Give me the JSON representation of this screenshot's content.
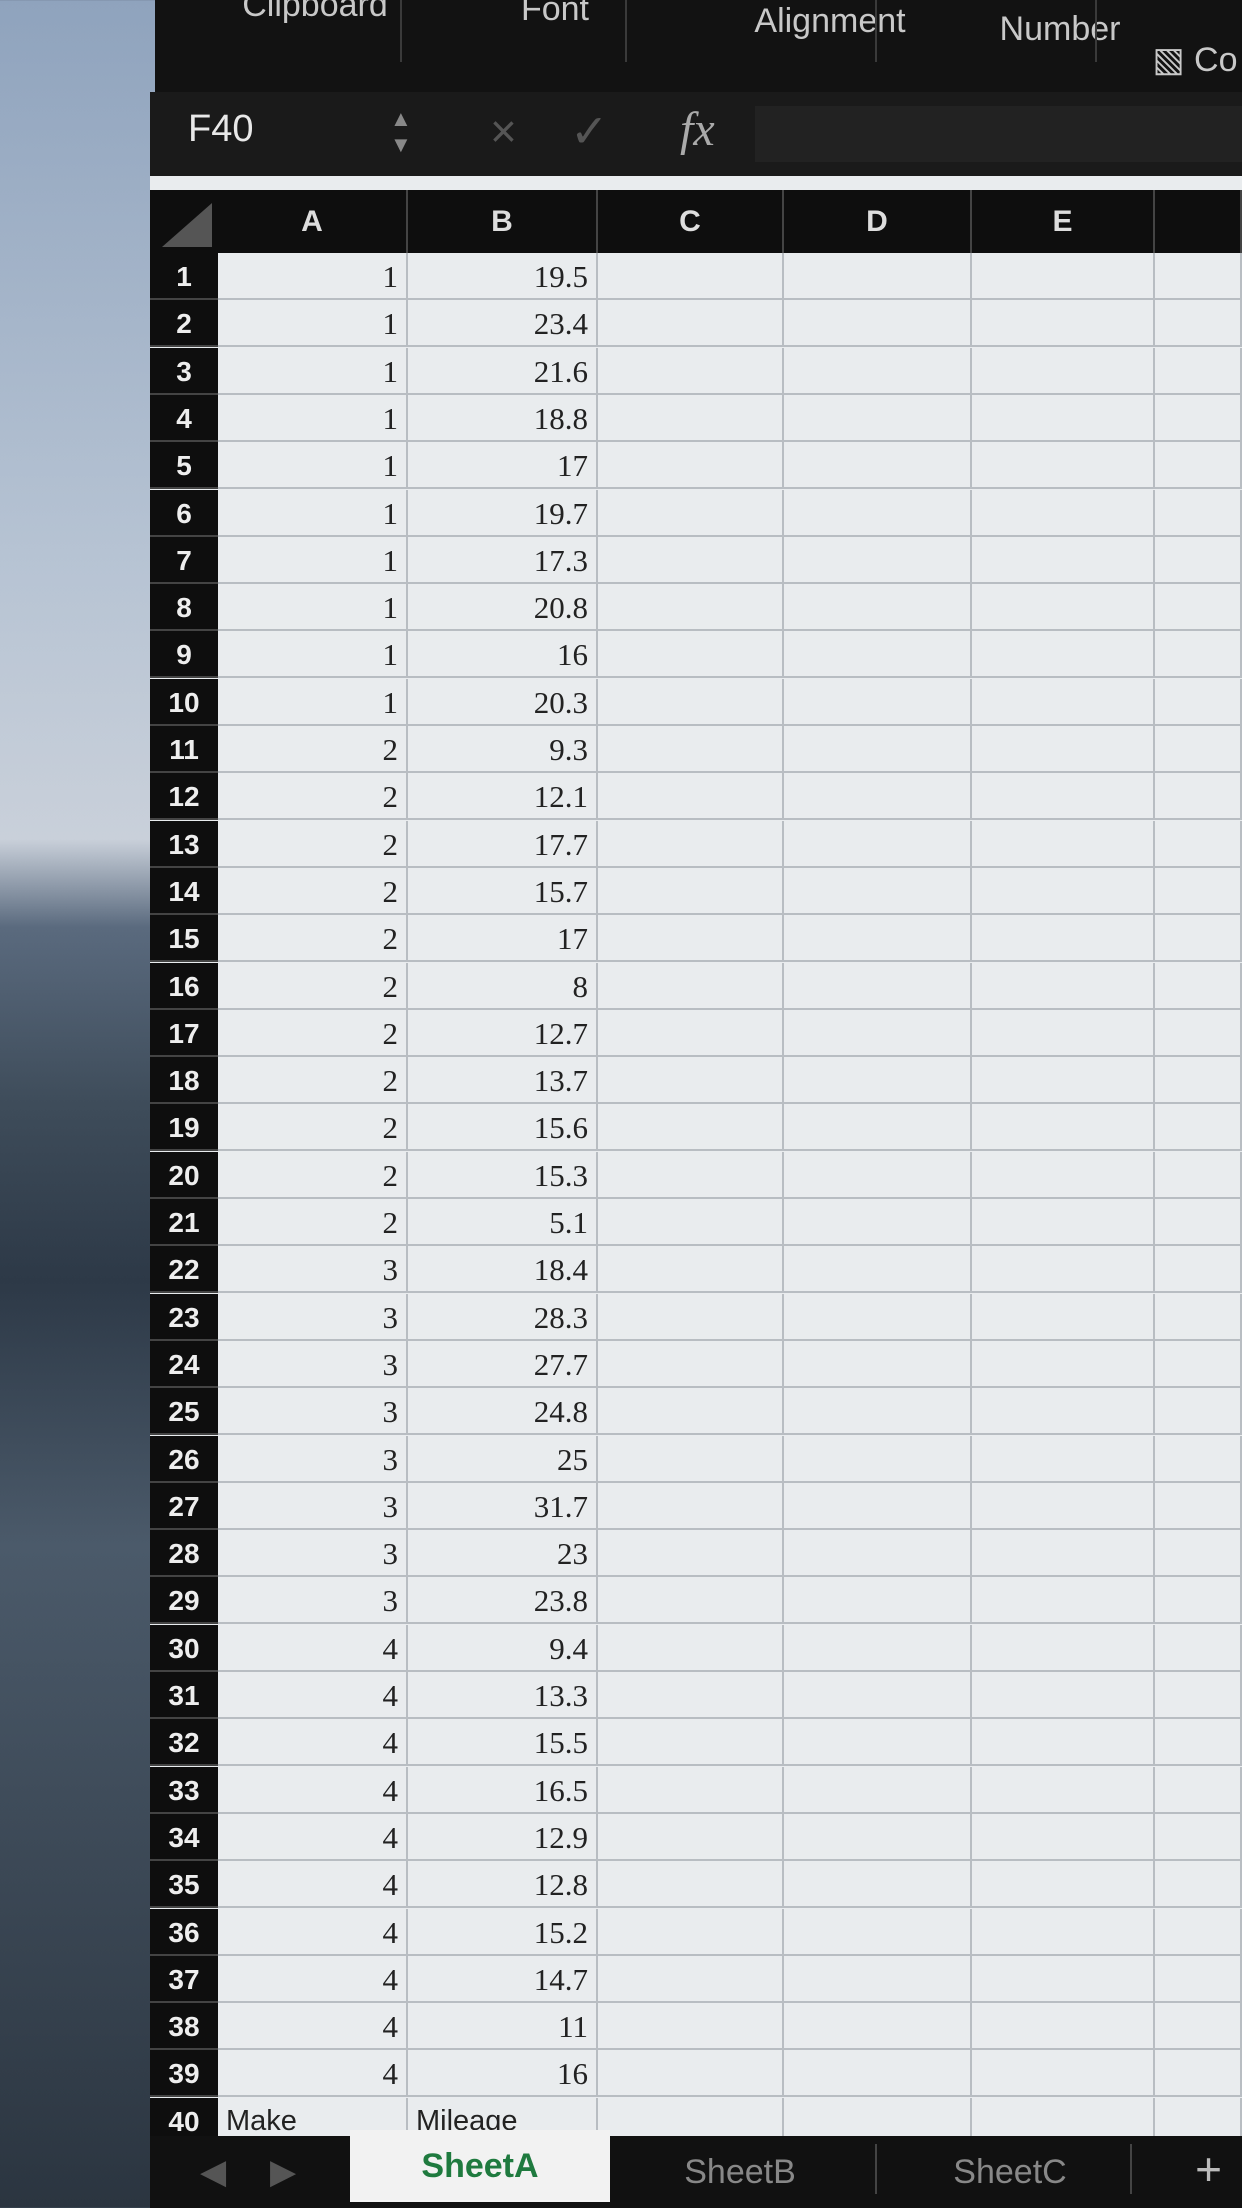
{
  "ribbon": {
    "groups": [
      "Clipboard",
      "Font",
      "Alignment",
      "Number"
    ],
    "partial": "Co"
  },
  "formula_bar": {
    "name_box": "F40",
    "cancel_icon": "×",
    "enter_icon": "✓",
    "fx_label": "fx",
    "value": ""
  },
  "columns": [
    "A",
    "B",
    "C",
    "D",
    "E",
    ""
  ],
  "rows": [
    [
      "1",
      "1",
      "19.5"
    ],
    [
      "2",
      "1",
      "23.4"
    ],
    [
      "3",
      "1",
      "21.6"
    ],
    [
      "4",
      "1",
      "18.8"
    ],
    [
      "5",
      "1",
      "17"
    ],
    [
      "6",
      "1",
      "19.7"
    ],
    [
      "7",
      "1",
      "17.3"
    ],
    [
      "8",
      "1",
      "20.8"
    ],
    [
      "9",
      "1",
      "16"
    ],
    [
      "10",
      "1",
      "20.3"
    ],
    [
      "11",
      "2",
      "9.3"
    ],
    [
      "12",
      "2",
      "12.1"
    ],
    [
      "13",
      "2",
      "17.7"
    ],
    [
      "14",
      "2",
      "15.7"
    ],
    [
      "15",
      "2",
      "17"
    ],
    [
      "16",
      "2",
      "8"
    ],
    [
      "17",
      "2",
      "12.7"
    ],
    [
      "18",
      "2",
      "13.7"
    ],
    [
      "19",
      "2",
      "15.6"
    ],
    [
      "20",
      "2",
      "15.3"
    ],
    [
      "21",
      "2",
      "5.1"
    ],
    [
      "22",
      "3",
      "18.4"
    ],
    [
      "23",
      "3",
      "28.3"
    ],
    [
      "24",
      "3",
      "27.7"
    ],
    [
      "25",
      "3",
      "24.8"
    ],
    [
      "26",
      "3",
      "25"
    ],
    [
      "27",
      "3",
      "31.7"
    ],
    [
      "28",
      "3",
      "23"
    ],
    [
      "29",
      "3",
      "23.8"
    ],
    [
      "30",
      "4",
      "9.4"
    ],
    [
      "31",
      "4",
      "13.3"
    ],
    [
      "32",
      "4",
      "15.5"
    ],
    [
      "33",
      "4",
      "16.5"
    ],
    [
      "34",
      "4",
      "12.9"
    ],
    [
      "35",
      "4",
      "12.8"
    ],
    [
      "36",
      "4",
      "15.2"
    ],
    [
      "37",
      "4",
      "14.7"
    ],
    [
      "38",
      "4",
      "11"
    ],
    [
      "39",
      "4",
      "16"
    ],
    [
      "40",
      "Make",
      "Mileage"
    ]
  ],
  "sheet_tabs": [
    {
      "label": "SheetA",
      "active": true
    },
    {
      "label": "SheetB",
      "active": false
    },
    {
      "label": "SheetC",
      "active": false
    }
  ],
  "add_sheet": "+",
  "colors": {
    "active_tab": "#1f7a3f",
    "header_bg": "#0e0e0e",
    "grid_bg": "#e9ecee"
  }
}
